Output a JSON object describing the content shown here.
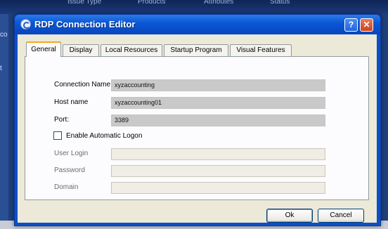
{
  "background": {
    "menu": [
      "Issue Type",
      "Products",
      "Attributes",
      "Status"
    ],
    "left_texts": [
      "co",
      "t"
    ]
  },
  "window": {
    "title": "RDP Connection Editor",
    "help_label": "?",
    "close_label": "✕"
  },
  "tabs": [
    {
      "label": "General",
      "active": true
    },
    {
      "label": "Display",
      "active": false
    },
    {
      "label": "Local Resources",
      "active": false
    },
    {
      "label": "Startup Program",
      "active": false
    },
    {
      "label": "Visual Features",
      "active": false
    }
  ],
  "form": {
    "connection_name": {
      "label": "Connection Name",
      "value": "xyzaccounting"
    },
    "host_name": {
      "label": "Host name",
      "value": "xyzaccounting01"
    },
    "port": {
      "label": "Port:",
      "value": "3389"
    },
    "auto_logon": {
      "label": "Enable Automatic Logon",
      "checked": false
    },
    "user_login": {
      "label": "User Login",
      "value": ""
    },
    "password": {
      "label": "Password",
      "value": ""
    },
    "domain": {
      "label": "Domain",
      "value": ""
    }
  },
  "buttons": {
    "ok": "Ok",
    "cancel": "Cancel"
  }
}
